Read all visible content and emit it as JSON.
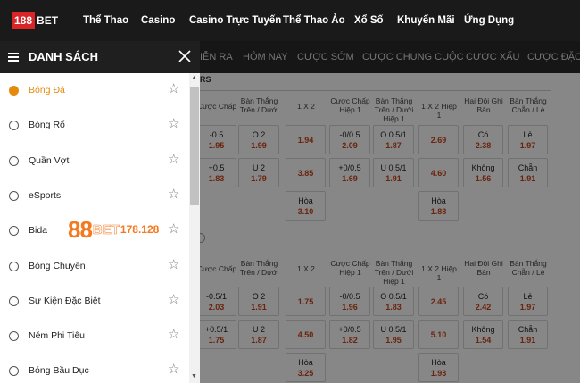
{
  "brand": {
    "logo_number": "188",
    "logo_text": "BET"
  },
  "topnav": [
    "Thể Thao",
    "Casino",
    "Casino Trực Tuyến",
    "Thể Thao Ảo",
    "Xổ Số",
    "Khuyến Mãi",
    "Ứng Dụng"
  ],
  "tabs": [
    "IỄN RA",
    "HÔM NAY",
    "CƯỢC SỚM",
    "CƯỢC CHUNG CUỘC",
    "CƯỢC XẤU",
    "CƯỢC ĐẶC BI"
  ],
  "subhead": "RS",
  "panel": {
    "title": "DANH SÁCH",
    "items": [
      {
        "label": "Bóng Đá",
        "icon": "soccer-icon",
        "active": true
      },
      {
        "label": "Bóng Rổ",
        "icon": "basketball-icon",
        "active": false
      },
      {
        "label": "Quần Vợt",
        "icon": "tennis-icon",
        "active": false
      },
      {
        "label": "eSports",
        "icon": "esports-icon",
        "active": false
      },
      {
        "label": "Bida",
        "icon": "billiards-icon",
        "active": false
      },
      {
        "label": "Bóng Chuyền",
        "icon": "volleyball-icon",
        "active": false
      },
      {
        "label": "Sự Kiện Đặc Biệt",
        "icon": "trophy-icon",
        "active": false
      },
      {
        "label": "Ném Phi Tiêu",
        "icon": "darts-icon",
        "active": false
      },
      {
        "label": "Bóng Bầu Dục",
        "icon": "rugby-icon",
        "active": false
      }
    ]
  },
  "columns": [
    "Cược Chấp",
    "Bàn Thắng Trên / Dưới",
    "1 X 2",
    "Cược Chấp Hiệp 1",
    "Bàn Thắng Trên / Dưới Hiệp 1",
    "1 X 2 Hiệp 1",
    "Hai Đội Ghi Bàn",
    "Bàn Thắng Chẵn / Lẻ"
  ],
  "matches": [
    {
      "rows": [
        [
          "-0.5|1.95",
          "O 2|1.99",
          "|1.94",
          "-0/0.5|2.09",
          "O 0.5/1|1.87",
          "|2.69",
          "Có|2.38",
          "Lẻ|1.97"
        ],
        [
          "+0.5|1.83",
          "U 2|1.79",
          "|3.85",
          "+0/0.5|1.69",
          "U 0.5/1|1.91",
          "|4.60",
          "Không|1.56",
          "Chẵn|1.91"
        ]
      ],
      "draw": [
        {
          "label": "Hòa",
          "odds": "3.10"
        },
        {
          "label": "Hòa",
          "odds": "1.88"
        }
      ]
    },
    {
      "rows": [
        [
          "-0.5/1|2.03",
          "O 2|1.91",
          "|1.75",
          "-0/0.5|1.96",
          "O 0.5/1|1.83",
          "|2.45",
          "Có|2.42",
          "Lẻ|1.97"
        ],
        [
          "+0.5/1|1.75",
          "U 2|1.87",
          "|4.50",
          "+0/0.5|1.82",
          "U 0.5/1|1.95",
          "|5.10",
          "Không|1.54",
          "Chẵn|1.91"
        ]
      ],
      "draw": [
        {
          "label": "Hòa",
          "odds": "3.25"
        },
        {
          "label": "Hòa",
          "odds": "1.93"
        }
      ]
    }
  ],
  "watermark": {
    "number": "88",
    "bet": "BET",
    "suffix": "178.128"
  },
  "colors": {
    "accent": "#e58a0c",
    "odds": "#c9431a",
    "logo_red": "#d92528",
    "watermark": "#f47920"
  }
}
